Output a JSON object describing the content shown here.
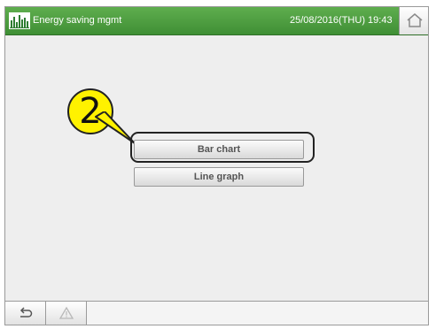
{
  "header": {
    "title": "Energy saving mgmt",
    "datetime": "25/08/2016(THU) 19:43",
    "logo_icon": "energy-bars-logo",
    "home_icon": "home-icon",
    "bar_color": "#4a9c3f"
  },
  "main": {
    "buttons": [
      {
        "label": "Bar chart"
      },
      {
        "label": "Line graph"
      }
    ],
    "step_badge": {
      "number": "2",
      "color": "#fff200"
    }
  },
  "footer": {
    "back_icon": "back-arrow-icon",
    "warning_icon": "warning-icon"
  }
}
